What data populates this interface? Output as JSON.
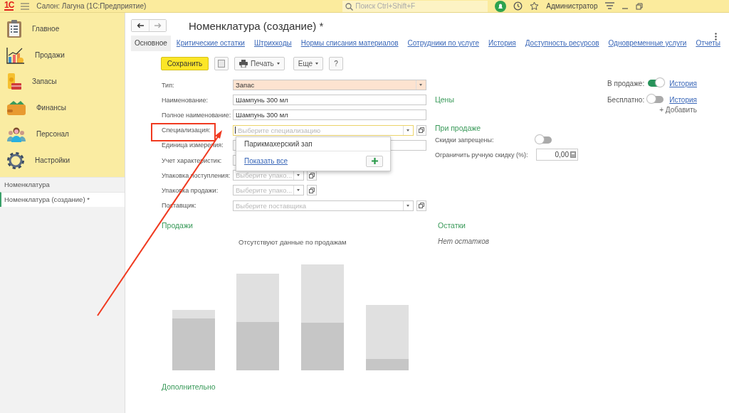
{
  "app_bar": {
    "logo": "1С",
    "title": "Салон: Лагуна  (1С:Предприятие)",
    "search": {
      "placeholder": "Поиск Ctrl+Shift+F"
    },
    "user": "Администратор"
  },
  "sidebar": {
    "sections": [
      {
        "label": "Главное",
        "kind": "clipboard"
      },
      {
        "label": "Продажи",
        "kind": "chart"
      },
      {
        "label": "Запасы",
        "kind": "goods"
      },
      {
        "label": "Финансы",
        "kind": "wallet"
      },
      {
        "label": "Персонал",
        "kind": "people"
      },
      {
        "label": "Настройки",
        "kind": "gear"
      }
    ],
    "open_windows": [
      {
        "label": "Номенклатура",
        "selected": false
      },
      {
        "label": "Номенклатура (создание) *",
        "selected": true
      }
    ]
  },
  "form": {
    "title": "Номенклатура (создание) *",
    "tabs": [
      {
        "label": "Основное",
        "selected": true
      },
      {
        "label": "Критические остатки",
        "selected": false
      },
      {
        "label": "Штрихкоды",
        "selected": false
      },
      {
        "label": "Нормы списания материалов",
        "selected": false
      },
      {
        "label": "Сотрудники по услуге",
        "selected": false
      },
      {
        "label": "История",
        "selected": false
      },
      {
        "label": "Доступность ресурсов",
        "selected": false
      },
      {
        "label": "Одновременные услуги",
        "selected": false
      },
      {
        "label": "Отчеты",
        "selected": false
      }
    ],
    "toolbar": {
      "save": "Сохранить",
      "print": "Печать",
      "more": "Еще",
      "help": "?"
    },
    "fields": [
      {
        "label": "Тип:",
        "kind": "select",
        "value": "Запас",
        "highlighted": true,
        "focused": false
      },
      {
        "label": "Наименование:",
        "kind": "text",
        "value": "Шампунь 300 мл",
        "highlighted": false,
        "focused": false
      },
      {
        "label": "Полное наименование:",
        "kind": "text",
        "value": "Шампунь 300 мл",
        "highlighted": false,
        "focused": false
      },
      {
        "label": "Специализация:",
        "kind": "select-open",
        "placeholder": "Выберите специализацию",
        "highlighted": false,
        "focused": true
      },
      {
        "label": "Единица измерения:",
        "kind": "text",
        "highlighted": false,
        "focused": false
      },
      {
        "label": "Учет характеристик:",
        "kind": "short",
        "highlighted": false,
        "focused": false
      },
      {
        "label": "Упаковка поступления:",
        "kind": "short-select",
        "placeholder": "Выберите упако...",
        "highlighted": false,
        "focused": false
      },
      {
        "label": "Упаковка продажи:",
        "kind": "short-select",
        "placeholder": "Выберите упако...",
        "highlighted": false,
        "focused": false
      },
      {
        "label": "Поставщик:",
        "kind": "select-open",
        "placeholder": "Выберите поставщика",
        "highlighted": false,
        "focused": false
      }
    ],
    "dropdown": {
      "items": [
        "Парикмахерский зап"
      ],
      "show_all": "Показать все"
    },
    "switches": [
      {
        "label": "В продаже:",
        "on": true,
        "link": "История"
      },
      {
        "label": "Бесплатно:",
        "on": false,
        "link": "История"
      }
    ],
    "prices": {
      "heading": "Цены",
      "add": "+ Добавить"
    },
    "on_sale": {
      "heading": "При продаже",
      "discounts_label": "Скидки запрещены:",
      "discounts_on": false,
      "limit_label": "Ограничить ручную скидку (%):",
      "limit_value": "0,00"
    },
    "sales": {
      "heading": "Продажи",
      "empty_message": "Отсутствуют данные по продажам"
    },
    "stock": {
      "heading": "Остатки",
      "empty_message": "Нет остатков"
    },
    "extra": {
      "heading": "Дополнительно"
    }
  }
}
